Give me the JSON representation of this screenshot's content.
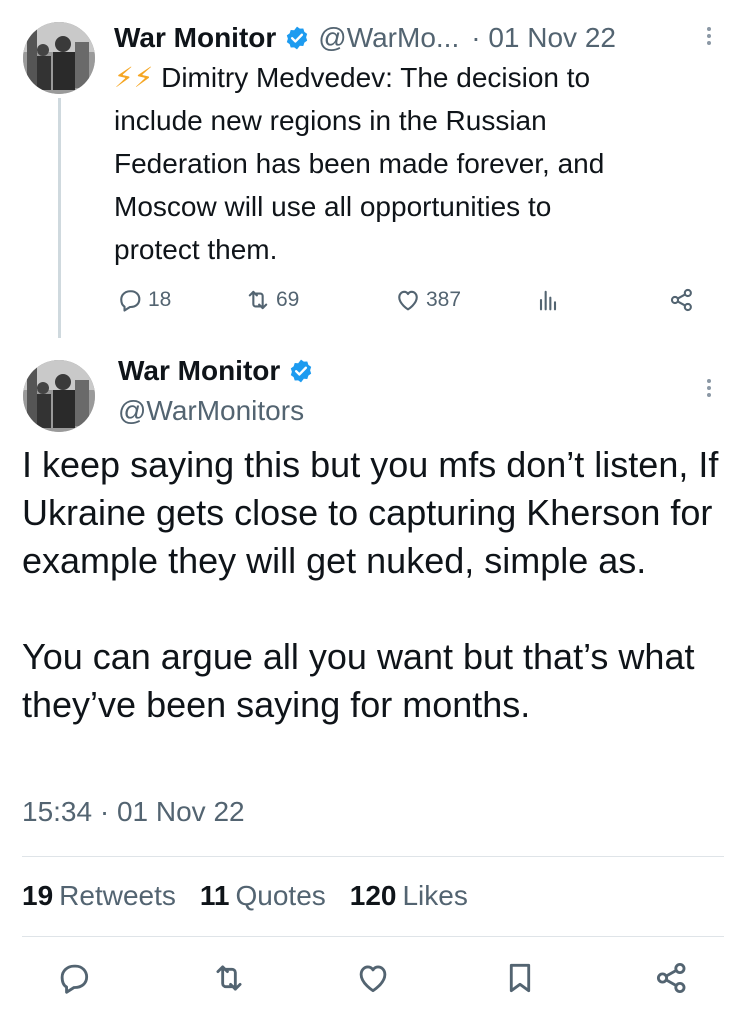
{
  "reply": {
    "author_name": "War Monitor",
    "handle": "@WarMo...",
    "date": "· 01 Nov 22",
    "bolts": "⚡⚡",
    "text_lines": [
      "Dimitry Medvedev: The decision to",
      "include new regions in the Russian",
      "Federation has been made forever, and",
      "Moscow will use all opportunities to",
      "protect them."
    ],
    "replies_count": "18",
    "retweets_count": "69",
    "likes_count": "387"
  },
  "tweet": {
    "author_name": "War Monitor",
    "handle": "@WarMonitors",
    "paragraphs": [
      "I keep saying this but you mfs don’t listen, If Ukraine gets close to capturing Kherson for example they will get nuked, simple as.",
      "You can argue all you want but that’s what they’ve been saying for months."
    ],
    "timestamp": "15:34 · 01 Nov 22"
  },
  "stats": {
    "retweets_value": "19",
    "retweets_label": "Retweets",
    "quotes_value": "11",
    "quotes_label": "Quotes",
    "likes_value": "120",
    "likes_label": "Likes"
  },
  "icons": {
    "verified": "verified-badge-icon",
    "reply": "reply-icon",
    "retweet": "retweet-icon",
    "like": "heart-icon",
    "views": "views-icon",
    "share": "share-icon",
    "bookmark": "bookmark-icon",
    "more": "more-vertical-icon"
  },
  "colors": {
    "verified": "#1d9bf0",
    "text": "#0f1419",
    "secondary": "#536471",
    "bolt": "#f5a623"
  }
}
